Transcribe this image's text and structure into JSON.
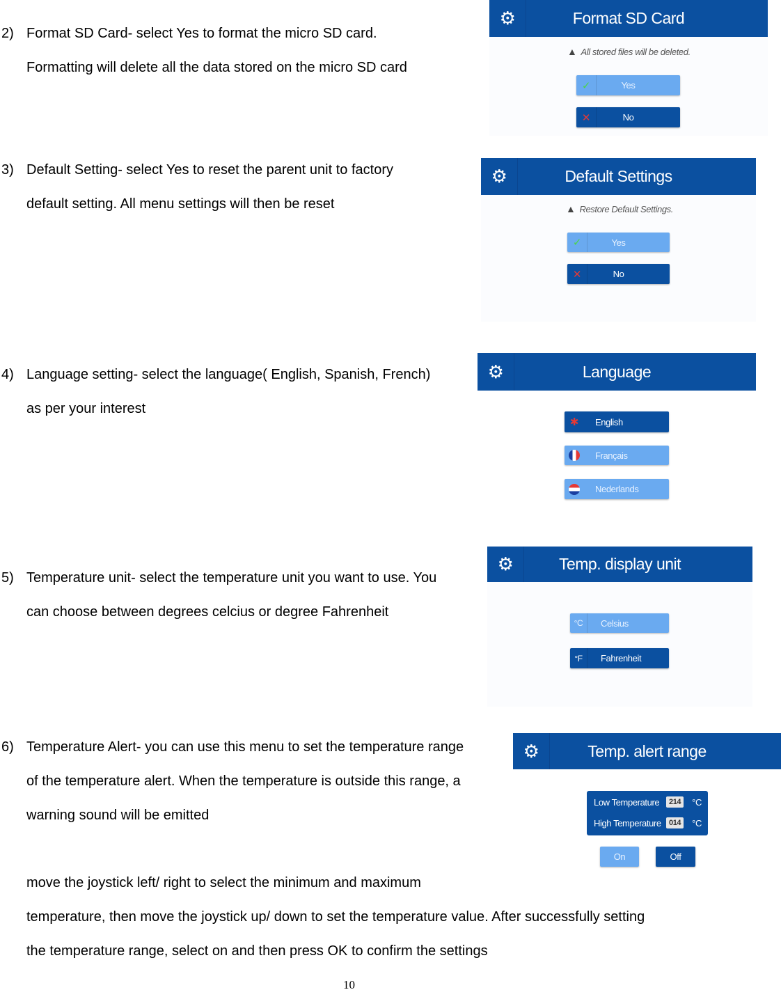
{
  "sections": [
    {
      "number": "2)",
      "lines": [
        "Format SD Card- select Yes to format the micro SD card.",
        "Formatting will delete all the data stored on the micro SD card"
      ],
      "panel": {
        "title": "Format SD Card",
        "warning": "All stored files will be deleted.",
        "yes": "Yes",
        "no": "No"
      }
    },
    {
      "number": "3)",
      "lines": [
        "Default Setting- select Yes to reset the parent unit to factory",
        "default setting. All menu settings will then be reset"
      ],
      "panel": {
        "title": "Default Settings",
        "warning": "Restore Default Settings.",
        "yes": "Yes",
        "no": "No"
      }
    },
    {
      "number": "4)",
      "lines": [
        "Language setting- select the language( English, Spanish, French)",
        "as per your interest"
      ],
      "panel": {
        "title": "Language",
        "options": [
          "English",
          "Français",
          "Nederlands"
        ]
      }
    },
    {
      "number": "5)",
      "lines": [
        "Temperature unit- select the temperature unit you want to use. You",
        "can choose between degrees celcius or degree Fahrenheit"
      ],
      "panel": {
        "title": "Temp. display unit",
        "options": [
          {
            "unit": "°C",
            "label": "Celsius"
          },
          {
            "unit": "°F",
            "label": "Fahrenheit"
          }
        ]
      }
    },
    {
      "number": "6)",
      "lines": [
        "Temperature Alert- you can use this menu to set the temperature range",
        "of the temperature alert. When the temperature is outside this range, a",
        "warning sound will be emitted"
      ],
      "panel": {
        "title": "Temp. alert range",
        "low_label": "Low Temperature",
        "low_value": "214",
        "high_label": "High Temperature",
        "high_value": "014",
        "unit": "°C",
        "on": "On",
        "off": "Off"
      }
    }
  ],
  "closing_lines": [
    "move the joystick left/ right to select the minimum and maximum",
    "temperature, then move the joystick up/ down to set the temperature value. After successfully setting",
    "the temperature range, select on and then press OK to confirm the settings"
  ],
  "page_number": "10",
  "colors": {
    "header": "#0b50a0",
    "button_light": "#6aaaf0",
    "button_dark": "#0b50a0"
  }
}
